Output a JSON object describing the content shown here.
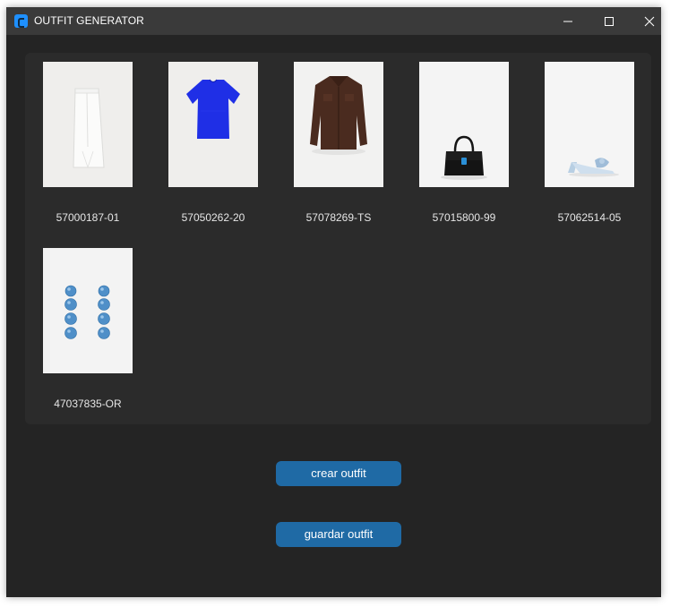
{
  "window": {
    "title": "OUTFIT GENERATOR"
  },
  "items": [
    {
      "code": "57000187-01",
      "icon": "white-skirt-image"
    },
    {
      "code": "57050262-20",
      "icon": "blue-tshirt-image"
    },
    {
      "code": "57078269-TS",
      "icon": "brown-shirt-image"
    },
    {
      "code": "57015800-99",
      "icon": "black-handbag-image"
    },
    {
      "code": "57062514-05",
      "icon": "blue-mule-heel-image"
    },
    {
      "code": "47037835-OR",
      "icon": "blue-drop-earrings-image"
    }
  ],
  "actions": {
    "create_label": "crear outfit",
    "save_label": "guardar outfit"
  },
  "colors": {
    "window_bg": "#242424",
    "titlebar_bg": "#3a3a3a",
    "frame_bg": "#2b2b2b",
    "button_bg": "#1f6aa5",
    "app_icon": "#1e90ff"
  }
}
